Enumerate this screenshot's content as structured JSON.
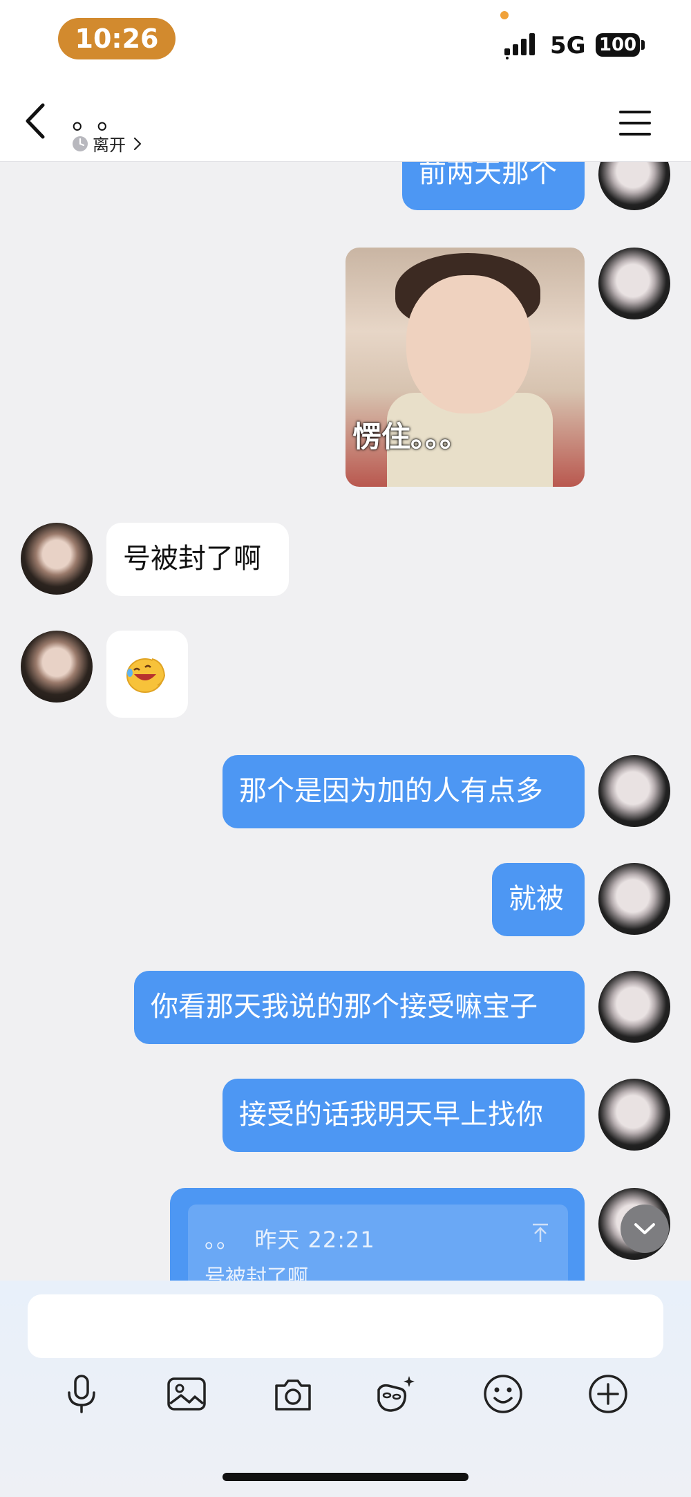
{
  "status_bar": {
    "time": "10:26",
    "network": "5G",
    "battery": "100"
  },
  "header": {
    "contact_name": "。。",
    "presence": "离开"
  },
  "messages": [
    {
      "side": "me",
      "kind": "text",
      "text": "前两天那个"
    },
    {
      "side": "me",
      "kind": "sticker",
      "caption": "愣住。。。"
    },
    {
      "side": "other",
      "kind": "text",
      "text": "号被封了啊"
    },
    {
      "side": "other",
      "kind": "emoji",
      "icon": "laughing-tears-emoji"
    },
    {
      "side": "me",
      "kind": "text",
      "text": "那个是因为加的人有点多"
    },
    {
      "side": "me",
      "kind": "text",
      "text": "就被"
    },
    {
      "side": "me",
      "kind": "text",
      "text": "你看那天我说的那个接受嘛宝子"
    },
    {
      "side": "me",
      "kind": "text",
      "text": "接受的话我明天早上找你"
    },
    {
      "side": "me",
      "kind": "reply",
      "quote_sender": "。。",
      "quote_time": "昨天 22:21",
      "quote_text": "号被封了啊"
    }
  ],
  "input": {
    "placeholder": ""
  },
  "toolbar": [
    "microphone-icon",
    "image-icon",
    "camera-icon",
    "sticker-icon",
    "emoji-icon",
    "plus-icon"
  ],
  "colors": {
    "my_bubble": "#4d97f3",
    "their_bubble": "#ffffff",
    "background": "#f0f0f2",
    "time_pill": "#d28a2e"
  }
}
